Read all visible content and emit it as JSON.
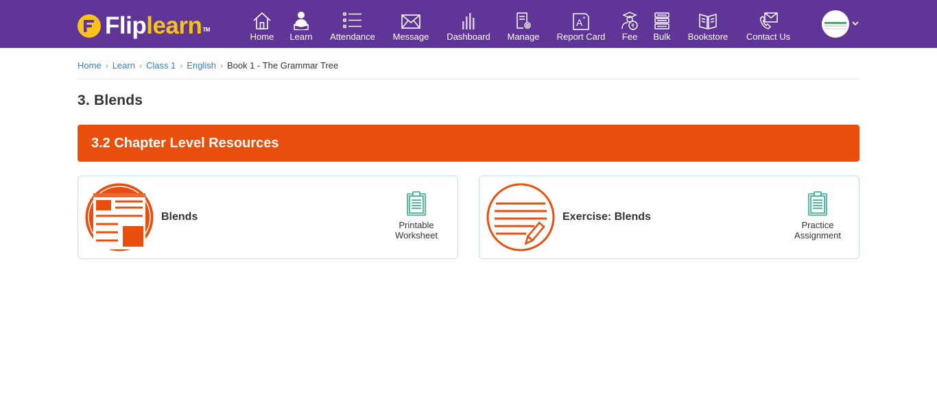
{
  "brand": {
    "part1": "Flip",
    "part2": "learn",
    "trademark": "TM",
    "logo_letter": "F",
    "accent": "#f7c21a"
  },
  "colors": {
    "topbar": "#5f3597",
    "banner": "#ea4e0c",
    "link": "#2f80d1"
  },
  "nav": [
    {
      "label": "Home",
      "icon": "home-icon"
    },
    {
      "label": "Learn",
      "icon": "learner-icon"
    },
    {
      "label": "Attendance",
      "icon": "list-icon"
    },
    {
      "label": "Message",
      "icon": "envelope-icon"
    },
    {
      "label": "Dashboard",
      "icon": "bar-chart-icon"
    },
    {
      "label": "Manage",
      "icon": "document-gear-icon"
    },
    {
      "label": "Report Card",
      "icon": "report-card-icon"
    },
    {
      "label": "Fee",
      "icon": "rupee-graduate-icon"
    },
    {
      "label": "Bulk",
      "icon": "stack-icon"
    },
    {
      "label": "Bookstore",
      "icon": "book-icon"
    },
    {
      "label": "Contact Us",
      "icon": "phone-envelope-icon"
    }
  ],
  "breadcrumb": {
    "items": [
      "Home",
      "Learn",
      "Class 1",
      "English"
    ],
    "current": "Book 1 - The Grammar Tree",
    "separator": "›"
  },
  "page": {
    "title": "3. Blends"
  },
  "section": {
    "title": "3.2 Chapter Level Resources"
  },
  "resources": [
    {
      "title": "Blends",
      "action_line1": "Printable",
      "action_line2": "Worksheet",
      "icon": "worksheet-icon",
      "action_icon": "clipboard-icon"
    },
    {
      "title": "Exercise: Blends",
      "action_line1": "Practice",
      "action_line2": "Assignment",
      "icon": "exercise-pencil-icon",
      "action_icon": "clipboard-icon"
    }
  ]
}
